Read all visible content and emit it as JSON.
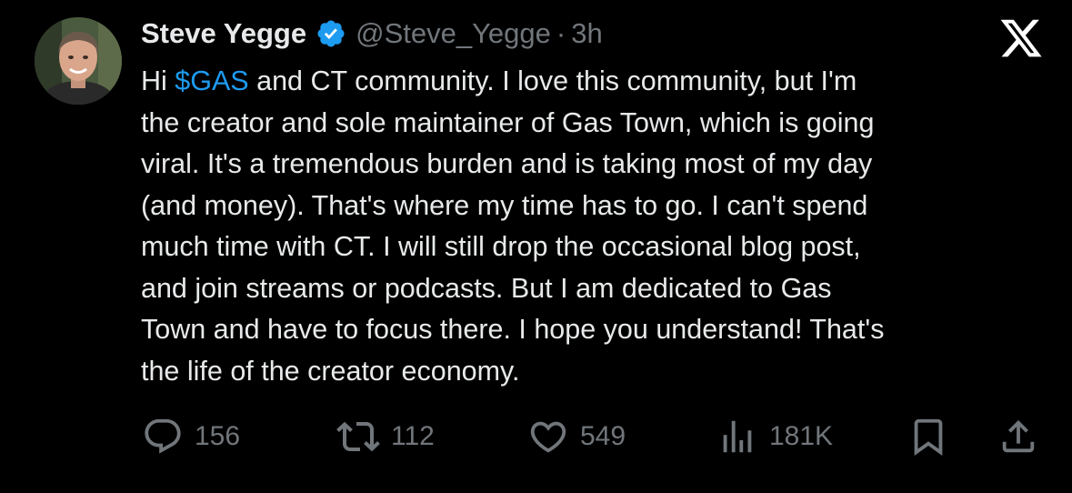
{
  "author": {
    "display_name": "Steve Yegge",
    "handle": "@Steve_Yegge",
    "separator": "·",
    "time": "3h",
    "verified_icon": "verified-badge-icon",
    "verified_color": "#1d9bf0"
  },
  "brand": {
    "logo_icon": "x-logo-icon"
  },
  "tweet": {
    "greeting": "Hi ",
    "cashtag": "$GAS",
    "line1_rest": " and CT community. I love this community, but I'm",
    "line2": "the creator and sole maintainer of Gas Town, which is going",
    "line3": "viral. It's a tremendous burden and is taking most of my day",
    "line4": "(and money). That's where my time has to go. I can't spend",
    "line5": "much time with CT. I will still drop the occasional blog post,",
    "line6": "and join streams or podcasts. But I am dedicated to Gas",
    "line7": "Town and have to focus there. I hope you understand! That's",
    "line8": "the life of the creator economy."
  },
  "actions": {
    "reply": {
      "icon": "reply-icon",
      "count": "156"
    },
    "retweet": {
      "icon": "retweet-icon",
      "count": "112"
    },
    "like": {
      "icon": "heart-icon",
      "count": "549"
    },
    "views": {
      "icon": "views-chart-icon",
      "count": "181K"
    },
    "bookmark": {
      "icon": "bookmark-icon"
    },
    "share": {
      "icon": "share-icon"
    }
  },
  "colors": {
    "background": "#000000",
    "text": "#e7e9ea",
    "muted": "#71767b",
    "link": "#1d9bf0"
  }
}
